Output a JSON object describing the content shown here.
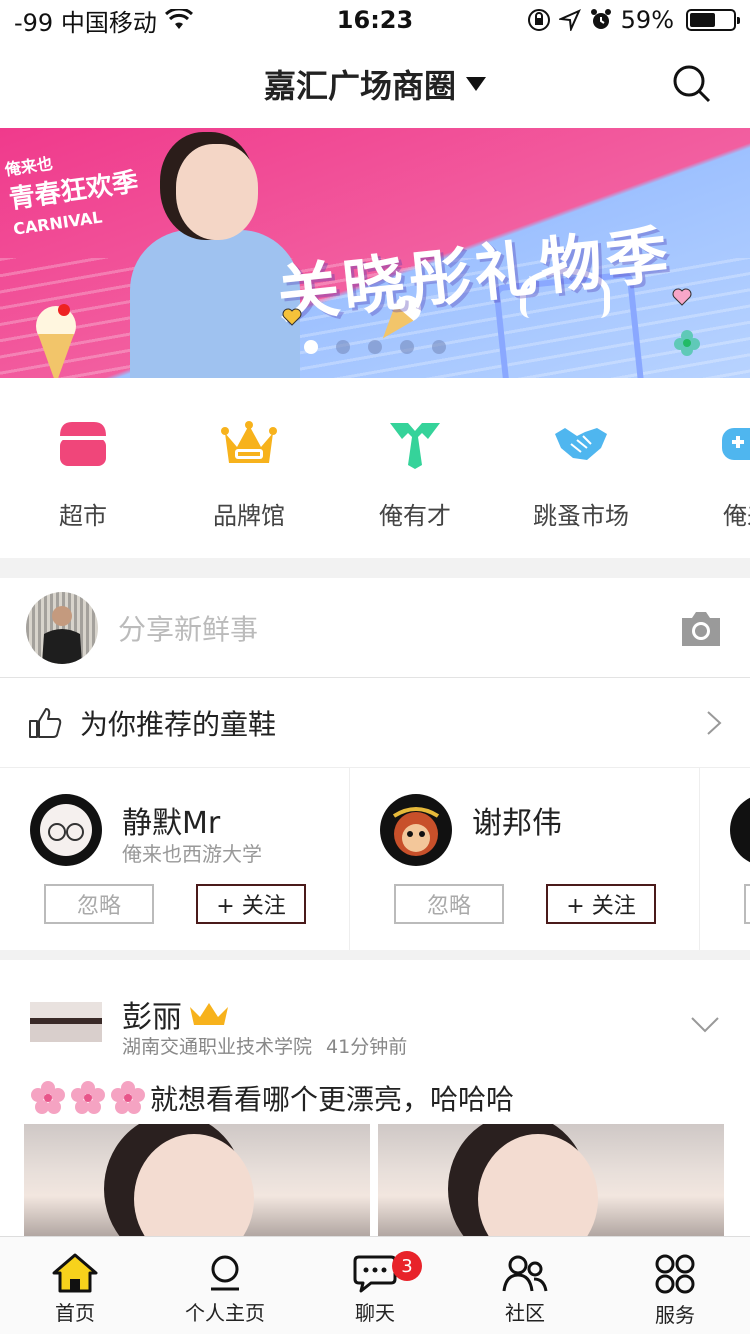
{
  "status_bar": {
    "carrier": "-99 中国移动",
    "time": "16:23",
    "battery": "59%",
    "battery_level": 0.59
  },
  "header": {
    "title": "嘉汇广场商圈"
  },
  "banner": {
    "badge_top": "俺来也",
    "badge_main": "青春狂欢季",
    "badge_en": "CARNIVAL",
    "headline": "关晓彤礼物季",
    "page_count": 5,
    "active_page": 1
  },
  "categories": [
    {
      "label": "超市",
      "icon": "store-icon",
      "color": "#f0467a"
    },
    {
      "label": "品牌馆",
      "icon": "crown-icon",
      "color": "#f7b21c"
    },
    {
      "label": "俺有才",
      "icon": "tie-icon",
      "color": "#35d39a"
    },
    {
      "label": "跳蚤市场",
      "icon": "handshake-icon",
      "color": "#4fb6ef"
    },
    {
      "label": "俺来",
      "icon": "gamepad-icon",
      "color": "#4fb6ef"
    }
  ],
  "share": {
    "placeholder": "分享新鲜事"
  },
  "recommend": {
    "title": "为你推荐的童鞋"
  },
  "suggested_users": [
    {
      "name": "静默Mr",
      "school": "俺来也西游大学",
      "ignore": "忽略",
      "follow": "+ 关注"
    },
    {
      "name": "谢邦伟",
      "school": "",
      "ignore": "忽略",
      "follow": "+ 关注"
    }
  ],
  "post": {
    "author": "彭丽",
    "school": "湖南交通职业技术学院",
    "time_ago": "41分钟前",
    "text": "就想看看哪个更漂亮，哈哈哈"
  },
  "tabbar": [
    {
      "label": "首页",
      "icon": "home-icon",
      "active": true
    },
    {
      "label": "个人主页",
      "icon": "person-icon"
    },
    {
      "label": "聊天",
      "icon": "chat-icon",
      "badge": "3"
    },
    {
      "label": "社区",
      "icon": "community-icon"
    },
    {
      "label": "服务",
      "icon": "grid-icon"
    }
  ]
}
